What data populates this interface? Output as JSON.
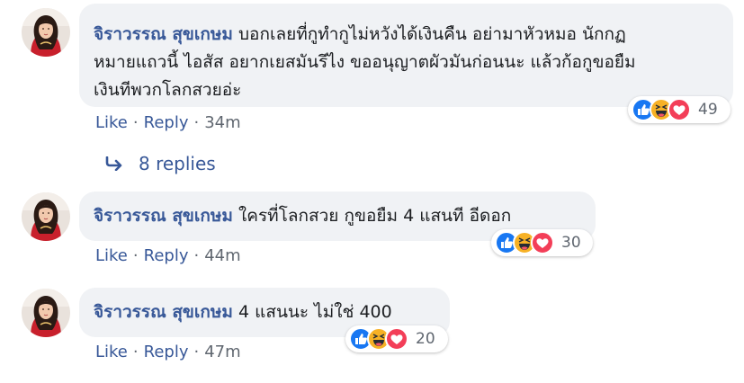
{
  "colors": {
    "name": "#385898",
    "link": "#385898",
    "muted": "#606770",
    "bubble": "#f0f2f5",
    "like": "#1877f2",
    "haha": "#f7b125",
    "love": "#f33e58"
  },
  "comments": [
    {
      "author": "จิราวรรณ สุขเกษม",
      "text_line1": "บอกเลยที่กูทำกูไม่หวังได้เงินคืน อย่ามาหัวหมอ นักกฏ",
      "text_line2": "หมายแถวนี้ ไอสัส อยากเยสมันรึไง ขออนุญาตผัวมันก่อนนะ แล้วก้อกูขอยืม",
      "text_line3": "เงินทีพวกโลกสวยอ่ะ",
      "like_label": "Like",
      "reply_label": "Reply",
      "time": "34m",
      "reaction_count": "49",
      "reaction_icons": [
        "like-icon",
        "haha-icon",
        "love-icon"
      ]
    },
    {
      "author": "จิราวรรณ สุขเกษม",
      "text": "ใครที่โลกสวย กูขอยืม 4 แสนที อีดอก",
      "like_label": "Like",
      "reply_label": "Reply",
      "time": "44m",
      "reaction_count": "30",
      "reaction_icons": [
        "like-icon",
        "haha-icon",
        "love-icon"
      ]
    },
    {
      "author": "จิราวรรณ สุขเกษม",
      "text": "4 แสนนะ ไม่ใช่ 400",
      "like_label": "Like",
      "reply_label": "Reply",
      "time": "47m",
      "reaction_count": "20",
      "reaction_icons": [
        "like-icon",
        "haha-icon",
        "love-icon"
      ]
    }
  ],
  "replies": {
    "label": "8 replies",
    "icon": "reply-arrow-icon"
  }
}
